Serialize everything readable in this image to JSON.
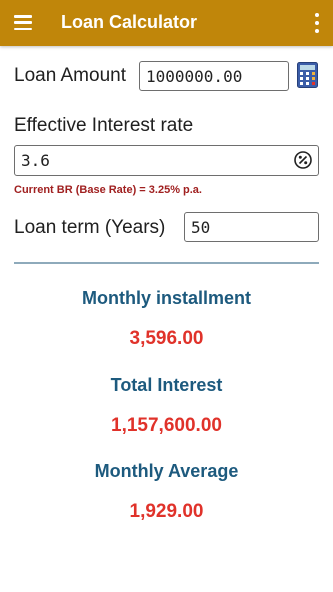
{
  "appbar": {
    "title": "Loan Calculator",
    "menu_icon": "hamburger-menu-icon",
    "overflow_icon": "more-vert-icon",
    "color": "#c0860a"
  },
  "form": {
    "loan_amount_label": "Loan Amount",
    "loan_amount_value": "1000000.00",
    "calculator_icon": "calculator-icon",
    "interest_label": "Effective Interest rate",
    "interest_value": "3.6",
    "percent_icon": "percent-circle-icon",
    "base_rate_note": "Current BR (Base Rate) = 3.25% p.a.",
    "term_label": "Loan term (Years)",
    "term_value": "50"
  },
  "results": {
    "monthly_installment_label": "Monthly installment",
    "monthly_installment_value": "3,596.00",
    "total_interest_label": "Total Interest",
    "total_interest_value": "1,157,600.00",
    "monthly_average_label": "Monthly Average",
    "monthly_average_value": "1,929.00",
    "heading_color": "#1d5a7e",
    "value_color": "#e0322a"
  }
}
